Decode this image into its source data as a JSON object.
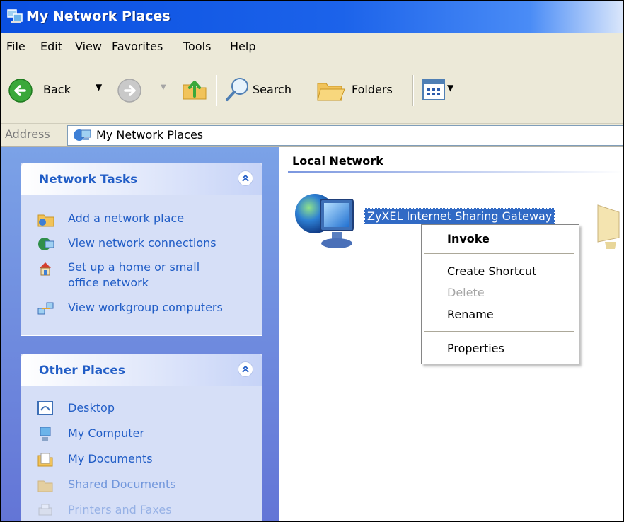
{
  "window": {
    "title": "My Network Places"
  },
  "menu": [
    "File",
    "Edit",
    "View",
    "Favorites",
    "Tools",
    "Help"
  ],
  "toolbar": {
    "back_label": "Back",
    "search_label": "Search",
    "folders_label": "Folders"
  },
  "address": {
    "label": "Address",
    "value": "My Network Places"
  },
  "network_tasks": {
    "title": "Network Tasks",
    "items": [
      {
        "label": "Add a network place",
        "icon": "add-network-place-icon"
      },
      {
        "label": "View network connections",
        "icon": "network-connections-icon"
      },
      {
        "label": "Set up a home or small office network",
        "icon": "home-network-icon"
      },
      {
        "label": "View workgroup computers",
        "icon": "workgroup-icon"
      }
    ]
  },
  "other_places": {
    "title": "Other Places",
    "items": [
      {
        "label": "Desktop",
        "icon": "desktop-icon"
      },
      {
        "label": "My Computer",
        "icon": "my-computer-icon"
      },
      {
        "label": "My Documents",
        "icon": "my-documents-icon"
      },
      {
        "label": "Shared Documents",
        "icon": "shared-documents-icon"
      },
      {
        "label": "Printers and Faxes",
        "icon": "printers-icon"
      }
    ]
  },
  "content": {
    "group_title": "Local Network",
    "item_label": "ZyXEL Internet Sharing Gateway"
  },
  "context_menu": {
    "items": [
      {
        "label": "Invoke",
        "bold": true,
        "enabled": true
      },
      {
        "label": "Create Shortcut",
        "enabled": true
      },
      {
        "label": "Delete",
        "enabled": false
      },
      {
        "label": "Rename",
        "enabled": true
      },
      {
        "label": "Properties",
        "enabled": true
      }
    ]
  },
  "colors": {
    "title_bar": "#0a4fe0",
    "task_link": "#215dc6",
    "selection": "#316ac5"
  }
}
